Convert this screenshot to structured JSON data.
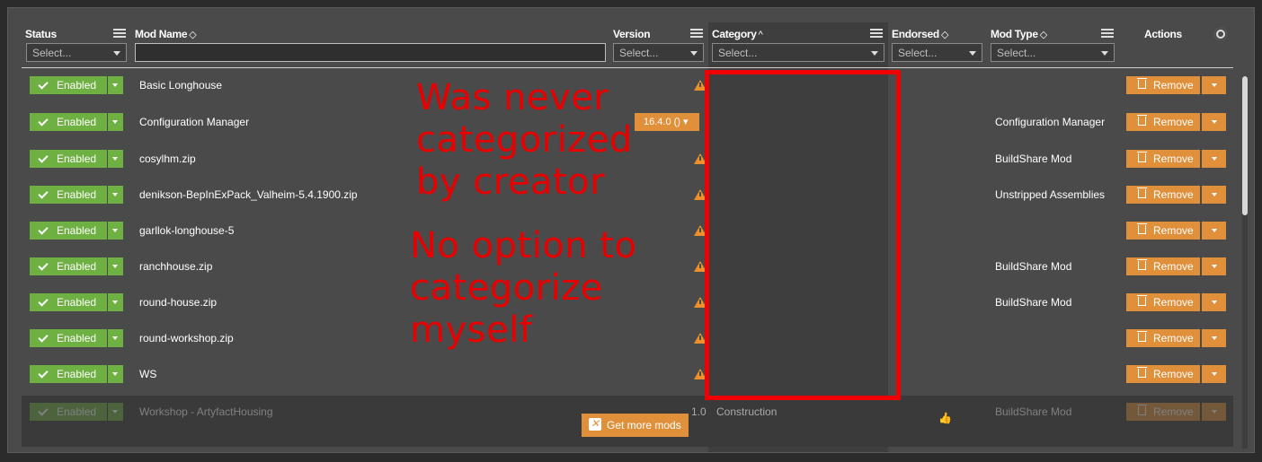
{
  "headers": {
    "status": "Status",
    "mod_name": "Mod Name",
    "version": "Version",
    "category": "Category",
    "endorsed": "Endorsed",
    "mod_type": "Mod Type",
    "actions": "Actions"
  },
  "sort_indicators": {
    "mod_name": "◇",
    "category": "^",
    "endorsed": "◇",
    "mod_type": "◇"
  },
  "filters": {
    "status_placeholder": "Select...",
    "version_placeholder": "Select...",
    "category_placeholder": "Select...",
    "endorsed_placeholder": "Select...",
    "mod_type_placeholder": "Select..."
  },
  "rows": [
    {
      "status": "Enabled",
      "name": "Basic Longhouse",
      "warning": true,
      "version": "",
      "mod_type": "",
      "action": "Remove"
    },
    {
      "status": "Enabled",
      "name": "Configuration Manager",
      "warning": false,
      "version": "16.4.0 ()",
      "mod_type": "Configuration Manager",
      "action": "Remove"
    },
    {
      "status": "Enabled",
      "name": "cosylhm.zip",
      "warning": true,
      "version": "",
      "mod_type": "BuildShare Mod",
      "action": "Remove"
    },
    {
      "status": "Enabled",
      "name": "denikson-BepInExPack_Valheim-5.4.1900.zip",
      "warning": true,
      "version": "",
      "mod_type": "Unstripped Assemblies",
      "action": "Remove"
    },
    {
      "status": "Enabled",
      "name": "garllok-longhouse-5",
      "warning": true,
      "version": "",
      "mod_type": "",
      "action": "Remove"
    },
    {
      "status": "Enabled",
      "name": "ranchhouse.zip",
      "warning": true,
      "version": "",
      "mod_type": "BuildShare Mod",
      "action": "Remove"
    },
    {
      "status": "Enabled",
      "name": "round-house.zip",
      "warning": true,
      "version": "",
      "mod_type": "BuildShare Mod",
      "action": "Remove"
    },
    {
      "status": "Enabled",
      "name": "round-workshop.zip",
      "warning": true,
      "version": "",
      "mod_type": "",
      "action": "Remove"
    },
    {
      "status": "Enabled",
      "name": "WS",
      "warning": true,
      "version": "",
      "mod_type": "",
      "action": "Remove"
    }
  ],
  "dimmed_row": {
    "status": "Enabled",
    "name": "Workshop - ArtyfactHousing",
    "version": "1.0",
    "category": "Construction",
    "mod_type": "BuildShare Mod",
    "action": "Remove"
  },
  "get_more_mods": "Get more mods",
  "annotations": {
    "note1": [
      "Was never",
      "categorized",
      "by creator"
    ],
    "note2": [
      "No option to",
      "categorize",
      "myself"
    ],
    "color": "#e80000"
  },
  "colors": {
    "enabled_green": "#6fb043",
    "action_orange": "#e0903a",
    "warning_orange": "#e8912d",
    "highlight_red": "#f00000"
  }
}
